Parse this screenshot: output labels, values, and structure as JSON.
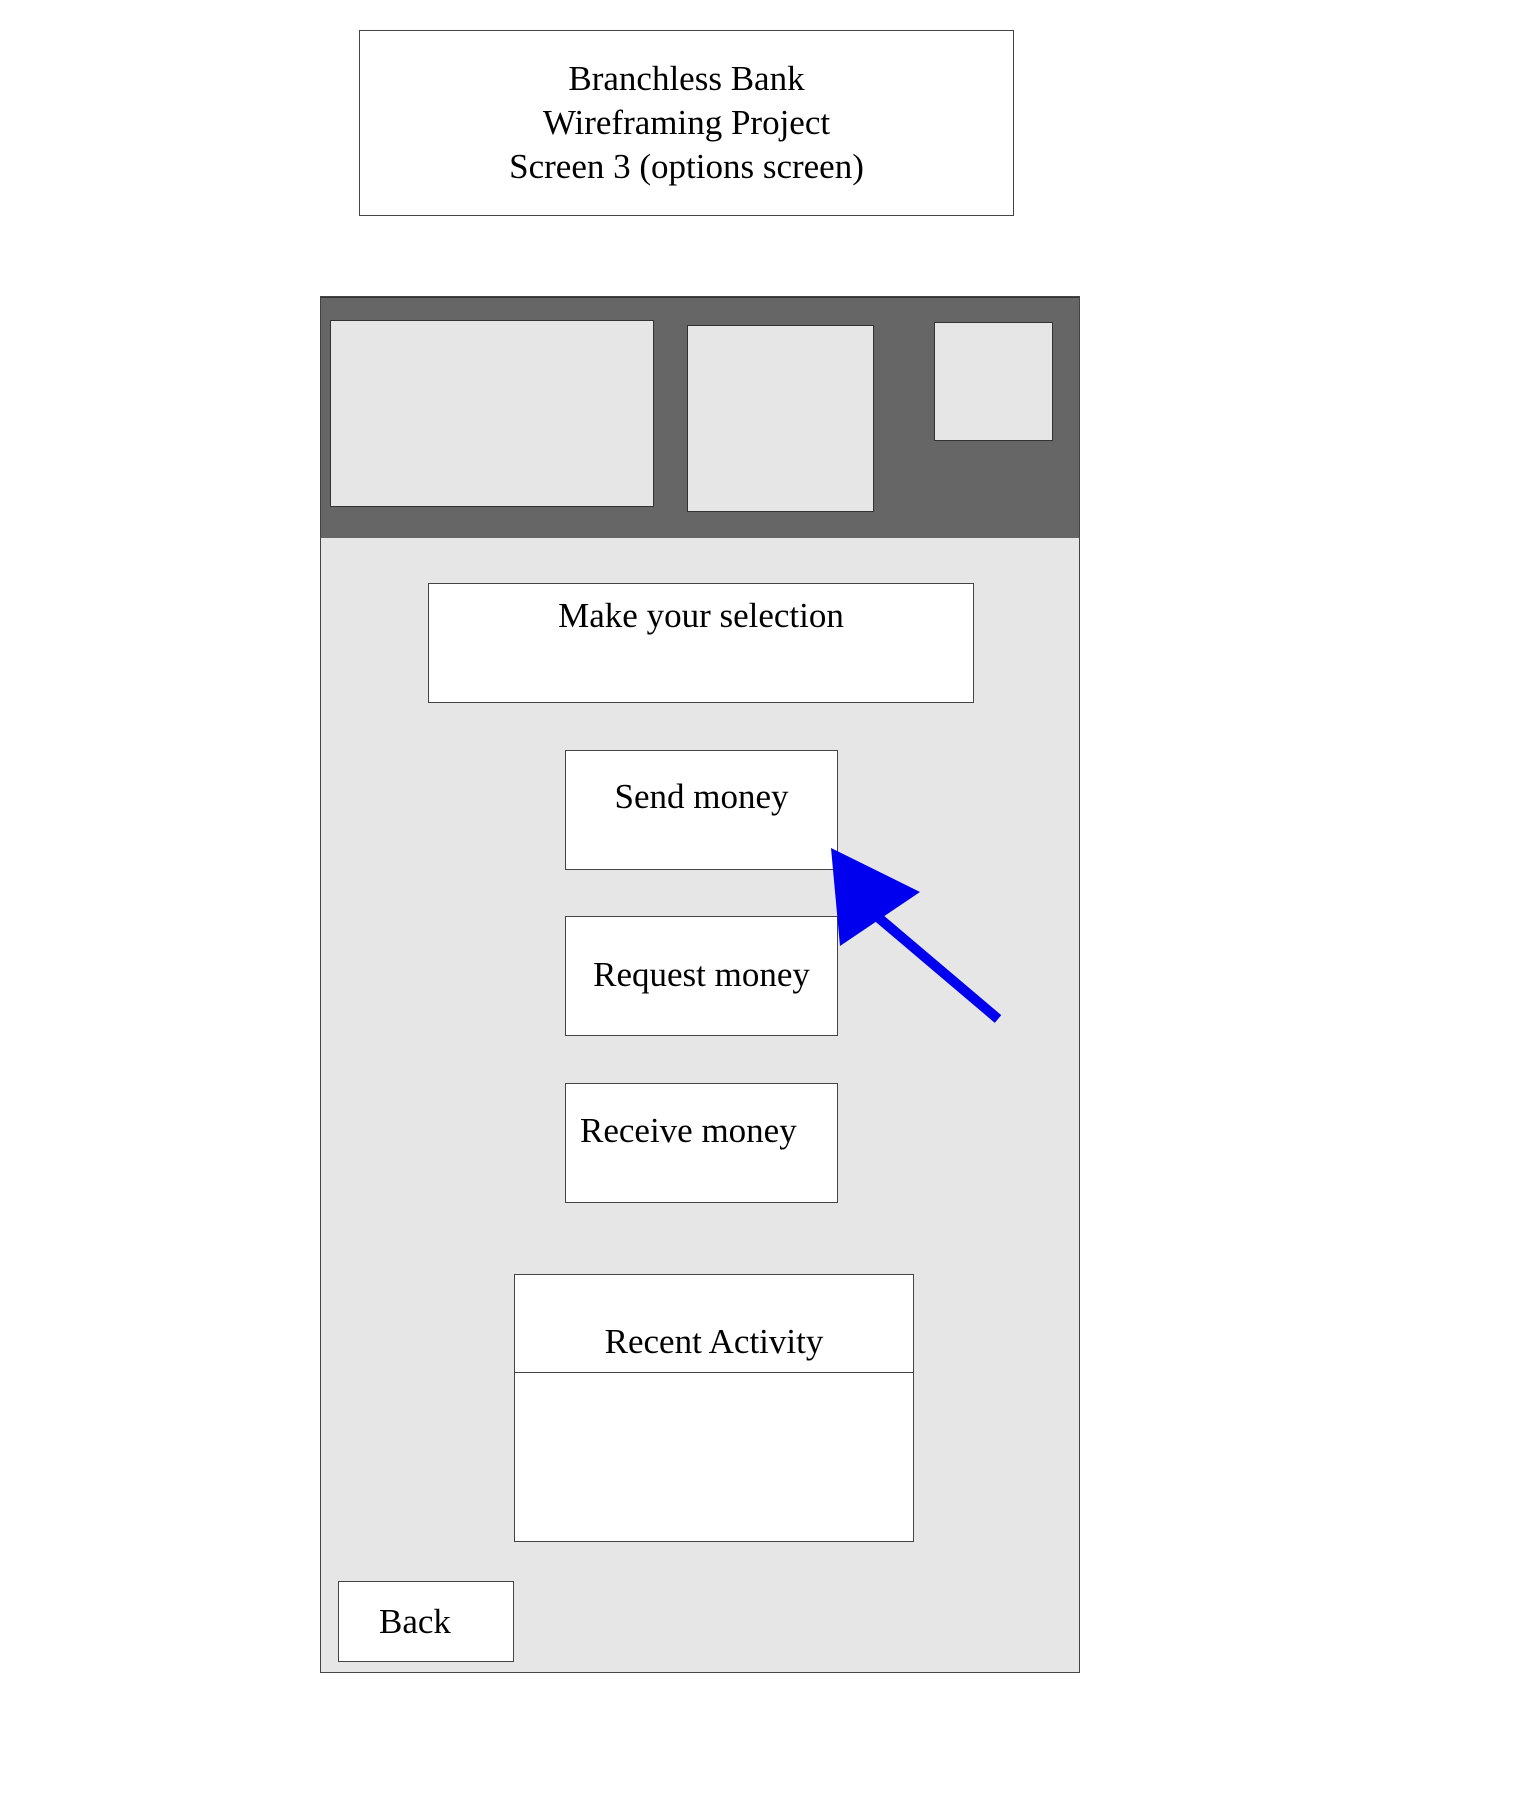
{
  "title_box": {
    "line1": "Branchless Bank",
    "line2": "Wireframing Project",
    "line3": "Screen 3 (options screen)"
  },
  "phone": {
    "header_color": "#666666",
    "body_color": "#e6e6e6",
    "selection_prompt": "Make your selection",
    "options": {
      "send": "Send money",
      "request": "Request money",
      "receive": "Receive money"
    },
    "recent_activity": {
      "title": "Recent Activity"
    },
    "back_label": "Back"
  },
  "annotation": {
    "arrow_color": "#0000ee",
    "points_to": "send-money-button"
  }
}
